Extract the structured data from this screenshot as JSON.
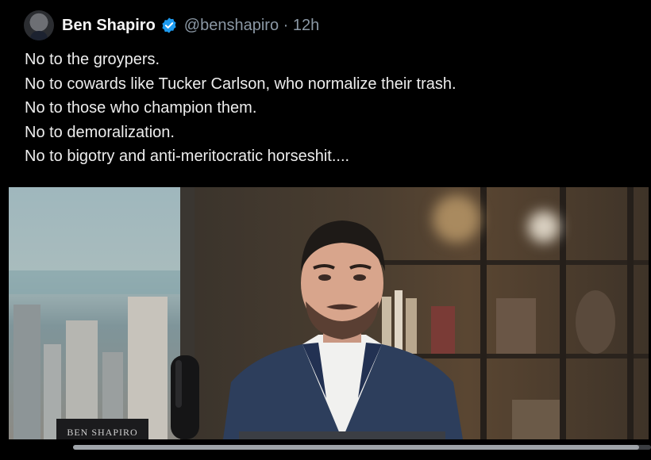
{
  "tweet": {
    "author": {
      "name": "Ben Shapiro",
      "handle": "@benshapiro",
      "separator": "·",
      "time": "12h",
      "verified_color": "#1d9bf0",
      "avatar_icon": "user-avatar"
    },
    "lines": [
      "No to the groypers.",
      "No to cowards like Tucker Carlson, who normalize their trash.",
      "No to those who champion them.",
      "No to demoralization.",
      "No to bigotry and anti-meritocratic horseshit...."
    ]
  },
  "media": {
    "type": "video",
    "plaque_text": "BEN SHAPIRO",
    "progress_fraction": 0.98
  },
  "colors": {
    "background": "#000000",
    "text": "#e7e9ea",
    "muted": "#8b98a5"
  }
}
